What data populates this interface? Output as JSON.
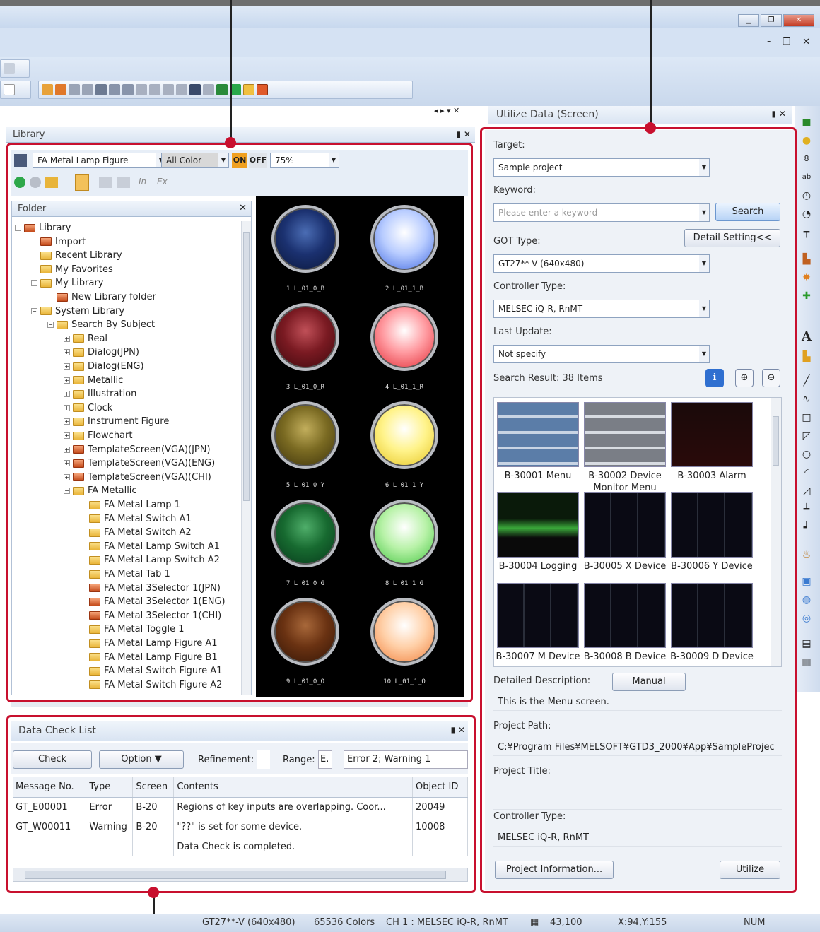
{
  "library": {
    "title": "Library",
    "figure_combo": "FA Metal Lamp Figure",
    "color_combo": "All Color",
    "on_label": "ON",
    "off_label": "OFF",
    "zoom": "75%",
    "folder_header": "Folder",
    "tree": [
      {
        "label": "Library",
        "indent": 0,
        "exp": "−",
        "kind": "lib"
      },
      {
        "label": "Import",
        "indent": 1,
        "exp": "",
        "kind": "import"
      },
      {
        "label": "Recent Library",
        "indent": 1,
        "exp": "",
        "kind": "folder"
      },
      {
        "label": "My Favorites",
        "indent": 1,
        "exp": "",
        "kind": "folder"
      },
      {
        "label": "My Library",
        "indent": 1,
        "exp": "−",
        "kind": "folder"
      },
      {
        "label": "New Library folder",
        "indent": 2,
        "exp": "",
        "kind": "red"
      },
      {
        "label": "System Library",
        "indent": 1,
        "exp": "−",
        "kind": "folder"
      },
      {
        "label": "Search By Subject",
        "indent": 2,
        "exp": "−",
        "kind": "folder"
      },
      {
        "label": "Real",
        "indent": 3,
        "exp": "+",
        "kind": "folder"
      },
      {
        "label": "Dialog(JPN)",
        "indent": 3,
        "exp": "+",
        "kind": "folder"
      },
      {
        "label": "Dialog(ENG)",
        "indent": 3,
        "exp": "+",
        "kind": "folder"
      },
      {
        "label": "Metallic",
        "indent": 3,
        "exp": "+",
        "kind": "folder"
      },
      {
        "label": "Illustration",
        "indent": 3,
        "exp": "+",
        "kind": "folder"
      },
      {
        "label": "Clock",
        "indent": 3,
        "exp": "+",
        "kind": "folder"
      },
      {
        "label": "Instrument Figure",
        "indent": 3,
        "exp": "+",
        "kind": "folder"
      },
      {
        "label": "Flowchart",
        "indent": 3,
        "exp": "+",
        "kind": "folder"
      },
      {
        "label": "TemplateScreen(VGA)(JPN)",
        "indent": 3,
        "exp": "+",
        "kind": "red"
      },
      {
        "label": "TemplateScreen(VGA)(ENG)",
        "indent": 3,
        "exp": "+",
        "kind": "red"
      },
      {
        "label": "TemplateScreen(VGA)(CHI)",
        "indent": 3,
        "exp": "+",
        "kind": "red"
      },
      {
        "label": "FA Metallic",
        "indent": 3,
        "exp": "−",
        "kind": "folder"
      },
      {
        "label": "FA Metal Lamp 1",
        "indent": 4,
        "exp": "",
        "kind": "folder"
      },
      {
        "label": "FA Metal Switch A1",
        "indent": 4,
        "exp": "",
        "kind": "folder"
      },
      {
        "label": "FA Metal Switch A2",
        "indent": 4,
        "exp": "",
        "kind": "folder"
      },
      {
        "label": "FA Metal Lamp Switch A1",
        "indent": 4,
        "exp": "",
        "kind": "folder"
      },
      {
        "label": "FA Metal Lamp Switch A2",
        "indent": 4,
        "exp": "",
        "kind": "folder"
      },
      {
        "label": "FA Metal Tab 1",
        "indent": 4,
        "exp": "",
        "kind": "folder"
      },
      {
        "label": "FA Metal 3Selector 1(JPN)",
        "indent": 4,
        "exp": "",
        "kind": "red"
      },
      {
        "label": "FA Metal 3Selector 1(ENG)",
        "indent": 4,
        "exp": "",
        "kind": "red"
      },
      {
        "label": "FA Metal 3Selector 1(CHI)",
        "indent": 4,
        "exp": "",
        "kind": "red"
      },
      {
        "label": "FA Metal Toggle 1",
        "indent": 4,
        "exp": "",
        "kind": "folder"
      },
      {
        "label": "FA Metal Lamp Figure A1",
        "indent": 4,
        "exp": "",
        "kind": "open"
      },
      {
        "label": "FA Metal Lamp Figure B1",
        "indent": 4,
        "exp": "",
        "kind": "folder"
      },
      {
        "label": "FA Metal Switch Figure A1",
        "indent": 4,
        "exp": "",
        "kind": "folder"
      },
      {
        "label": "FA Metal Switch Figure A2",
        "indent": 4,
        "exp": "",
        "kind": "folder"
      }
    ],
    "lamps": [
      {
        "label": "1 L_01_0_B",
        "c1": "#4b6db4",
        "c2": "#1b3170",
        "c3": "#0a1638"
      },
      {
        "label": "2 L_01_1_B",
        "c1": "#ffffff",
        "c2": "#b8ccff",
        "c3": "#3a64e0"
      },
      {
        "label": "3 L_01_0_R",
        "c1": "#c05058",
        "c2": "#7a1a22",
        "c3": "#3a070c"
      },
      {
        "label": "4 L_01_1_R",
        "c1": "#ffffff",
        "c2": "#ff9aa0",
        "c3": "#e0242e"
      },
      {
        "label": "5 L_01_0_Y",
        "c1": "#c2ae5c",
        "c2": "#7a6a22",
        "c3": "#3a300a"
      },
      {
        "label": "6 L_01_1_Y",
        "c1": "#ffffff",
        "c2": "#fff38a",
        "c3": "#e4c21c"
      },
      {
        "label": "7 L_01_0_G",
        "c1": "#4fae6a",
        "c2": "#176a30",
        "c3": "#06361a"
      },
      {
        "label": "8 L_01_1_G",
        "c1": "#ffffff",
        "c2": "#b8f2a8",
        "c3": "#3cc23a"
      },
      {
        "label": "9 L_01_0_O",
        "c1": "#a8683a",
        "c2": "#6a3212",
        "c3": "#301406"
      },
      {
        "label": "10 L_01_1_O",
        "c1": "#ffffff",
        "c2": "#ffd0a8",
        "c3": "#f07a34"
      }
    ]
  },
  "datacheck": {
    "title": "Data Check List",
    "check_btn": "Check",
    "option_btn": "Option",
    "refinement_label": "Refinement:",
    "range_label": "Range:",
    "range_value": "E.",
    "summary": "Error 2; Warning 1",
    "columns": [
      "Message No.",
      "Type",
      "Screen",
      "Contents",
      "Object ID"
    ],
    "rows": [
      [
        "GT_E00001",
        "Error",
        "B-20",
        "Regions of key inputs are overlapping. Coor...",
        "20049"
      ],
      [
        "GT_W00011",
        "Warning",
        "B-20",
        "\"??\" is set for some device.",
        "10008"
      ],
      [
        "",
        "",
        "",
        "Data Check is completed.",
        ""
      ]
    ]
  },
  "utilize": {
    "title": "Utilize Data (Screen)",
    "target_label": "Target:",
    "target_value": "Sample project",
    "keyword_label": "Keyword:",
    "keyword_placeholder": "Please enter a keyword",
    "search_btn": "Search",
    "detail_btn": "Detail Setting<<",
    "got_label": "GOT Type:",
    "got_value": "GT27**-V (640x480)",
    "ctrl_label": "Controller Type:",
    "ctrl_value": "MELSEC iQ-R, RnMT",
    "update_label": "Last Update:",
    "update_value": "Not specify",
    "result_label": "Search Result: 38 Items",
    "thumbs": [
      {
        "cap": "B-30001 Menu",
        "style": "menu"
      },
      {
        "cap": "B-30002 Device Monitor Menu",
        "style": "gray"
      },
      {
        "cap": "B-30003 Alarm",
        "style": "alarm"
      },
      {
        "cap": "B-30004 Logging",
        "style": "log"
      },
      {
        "cap": "B-30005 X Device",
        "style": "dark"
      },
      {
        "cap": "B-30006 Y Device",
        "style": "dark"
      },
      {
        "cap": "B-30007 M Device",
        "style": "dark"
      },
      {
        "cap": "B-30008 B Device",
        "style": "dark"
      },
      {
        "cap": "B-30009 D Device",
        "style": "dark"
      }
    ],
    "desc_label": "Detailed Description:",
    "manual_btn": "Manual",
    "desc_value": "This is the Menu screen.",
    "path_label": "Project Path:",
    "path_value": "C:¥Program Files¥MELSOFT¥GTD3_2000¥App¥SampleProjec",
    "ptitle_label": "Project Title:",
    "ptitle_value": "",
    "ctrl2_label": "Controller Type:",
    "ctrl2_value": "MELSEC iQ-R, RnMT",
    "projinfo_btn": "Project Information...",
    "utilize_btn": "Utilize"
  },
  "status": {
    "got": "GT27**-V (640x480)",
    "colors": "65536 Colors",
    "channel": "CH 1 : MELSEC iQ-R, RnMT",
    "coord": "43,100",
    "cursor": "X:94,Y:155",
    "num": "NUM"
  }
}
